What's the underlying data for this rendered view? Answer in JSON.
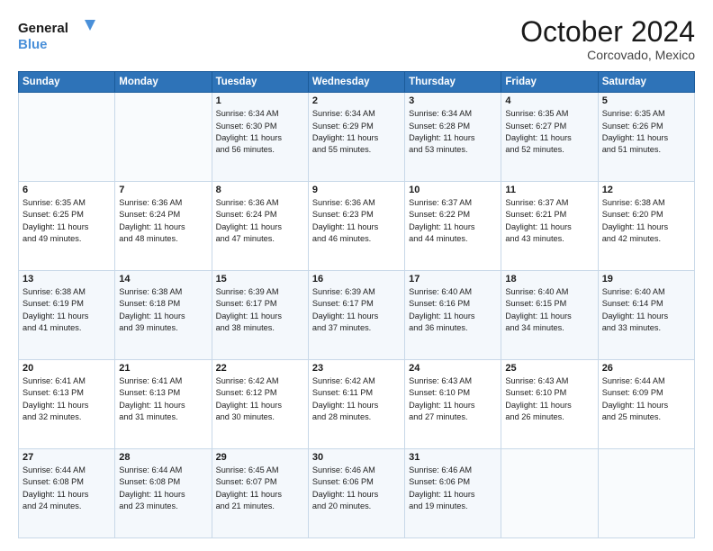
{
  "header": {
    "logo_line1": "General",
    "logo_line2": "Blue",
    "month": "October 2024",
    "location": "Corcovado, Mexico"
  },
  "days_of_week": [
    "Sunday",
    "Monday",
    "Tuesday",
    "Wednesday",
    "Thursday",
    "Friday",
    "Saturday"
  ],
  "weeks": [
    [
      {
        "day": "",
        "info": ""
      },
      {
        "day": "",
        "info": ""
      },
      {
        "day": "1",
        "info": "Sunrise: 6:34 AM\nSunset: 6:30 PM\nDaylight: 11 hours\nand 56 minutes."
      },
      {
        "day": "2",
        "info": "Sunrise: 6:34 AM\nSunset: 6:29 PM\nDaylight: 11 hours\nand 55 minutes."
      },
      {
        "day": "3",
        "info": "Sunrise: 6:34 AM\nSunset: 6:28 PM\nDaylight: 11 hours\nand 53 minutes."
      },
      {
        "day": "4",
        "info": "Sunrise: 6:35 AM\nSunset: 6:27 PM\nDaylight: 11 hours\nand 52 minutes."
      },
      {
        "day": "5",
        "info": "Sunrise: 6:35 AM\nSunset: 6:26 PM\nDaylight: 11 hours\nand 51 minutes."
      }
    ],
    [
      {
        "day": "6",
        "info": "Sunrise: 6:35 AM\nSunset: 6:25 PM\nDaylight: 11 hours\nand 49 minutes."
      },
      {
        "day": "7",
        "info": "Sunrise: 6:36 AM\nSunset: 6:24 PM\nDaylight: 11 hours\nand 48 minutes."
      },
      {
        "day": "8",
        "info": "Sunrise: 6:36 AM\nSunset: 6:24 PM\nDaylight: 11 hours\nand 47 minutes."
      },
      {
        "day": "9",
        "info": "Sunrise: 6:36 AM\nSunset: 6:23 PM\nDaylight: 11 hours\nand 46 minutes."
      },
      {
        "day": "10",
        "info": "Sunrise: 6:37 AM\nSunset: 6:22 PM\nDaylight: 11 hours\nand 44 minutes."
      },
      {
        "day": "11",
        "info": "Sunrise: 6:37 AM\nSunset: 6:21 PM\nDaylight: 11 hours\nand 43 minutes."
      },
      {
        "day": "12",
        "info": "Sunrise: 6:38 AM\nSunset: 6:20 PM\nDaylight: 11 hours\nand 42 minutes."
      }
    ],
    [
      {
        "day": "13",
        "info": "Sunrise: 6:38 AM\nSunset: 6:19 PM\nDaylight: 11 hours\nand 41 minutes."
      },
      {
        "day": "14",
        "info": "Sunrise: 6:38 AM\nSunset: 6:18 PM\nDaylight: 11 hours\nand 39 minutes."
      },
      {
        "day": "15",
        "info": "Sunrise: 6:39 AM\nSunset: 6:17 PM\nDaylight: 11 hours\nand 38 minutes."
      },
      {
        "day": "16",
        "info": "Sunrise: 6:39 AM\nSunset: 6:17 PM\nDaylight: 11 hours\nand 37 minutes."
      },
      {
        "day": "17",
        "info": "Sunrise: 6:40 AM\nSunset: 6:16 PM\nDaylight: 11 hours\nand 36 minutes."
      },
      {
        "day": "18",
        "info": "Sunrise: 6:40 AM\nSunset: 6:15 PM\nDaylight: 11 hours\nand 34 minutes."
      },
      {
        "day": "19",
        "info": "Sunrise: 6:40 AM\nSunset: 6:14 PM\nDaylight: 11 hours\nand 33 minutes."
      }
    ],
    [
      {
        "day": "20",
        "info": "Sunrise: 6:41 AM\nSunset: 6:13 PM\nDaylight: 11 hours\nand 32 minutes."
      },
      {
        "day": "21",
        "info": "Sunrise: 6:41 AM\nSunset: 6:13 PM\nDaylight: 11 hours\nand 31 minutes."
      },
      {
        "day": "22",
        "info": "Sunrise: 6:42 AM\nSunset: 6:12 PM\nDaylight: 11 hours\nand 30 minutes."
      },
      {
        "day": "23",
        "info": "Sunrise: 6:42 AM\nSunset: 6:11 PM\nDaylight: 11 hours\nand 28 minutes."
      },
      {
        "day": "24",
        "info": "Sunrise: 6:43 AM\nSunset: 6:10 PM\nDaylight: 11 hours\nand 27 minutes."
      },
      {
        "day": "25",
        "info": "Sunrise: 6:43 AM\nSunset: 6:10 PM\nDaylight: 11 hours\nand 26 minutes."
      },
      {
        "day": "26",
        "info": "Sunrise: 6:44 AM\nSunset: 6:09 PM\nDaylight: 11 hours\nand 25 minutes."
      }
    ],
    [
      {
        "day": "27",
        "info": "Sunrise: 6:44 AM\nSunset: 6:08 PM\nDaylight: 11 hours\nand 24 minutes."
      },
      {
        "day": "28",
        "info": "Sunrise: 6:44 AM\nSunset: 6:08 PM\nDaylight: 11 hours\nand 23 minutes."
      },
      {
        "day": "29",
        "info": "Sunrise: 6:45 AM\nSunset: 6:07 PM\nDaylight: 11 hours\nand 21 minutes."
      },
      {
        "day": "30",
        "info": "Sunrise: 6:46 AM\nSunset: 6:06 PM\nDaylight: 11 hours\nand 20 minutes."
      },
      {
        "day": "31",
        "info": "Sunrise: 6:46 AM\nSunset: 6:06 PM\nDaylight: 11 hours\nand 19 minutes."
      },
      {
        "day": "",
        "info": ""
      },
      {
        "day": "",
        "info": ""
      }
    ]
  ]
}
